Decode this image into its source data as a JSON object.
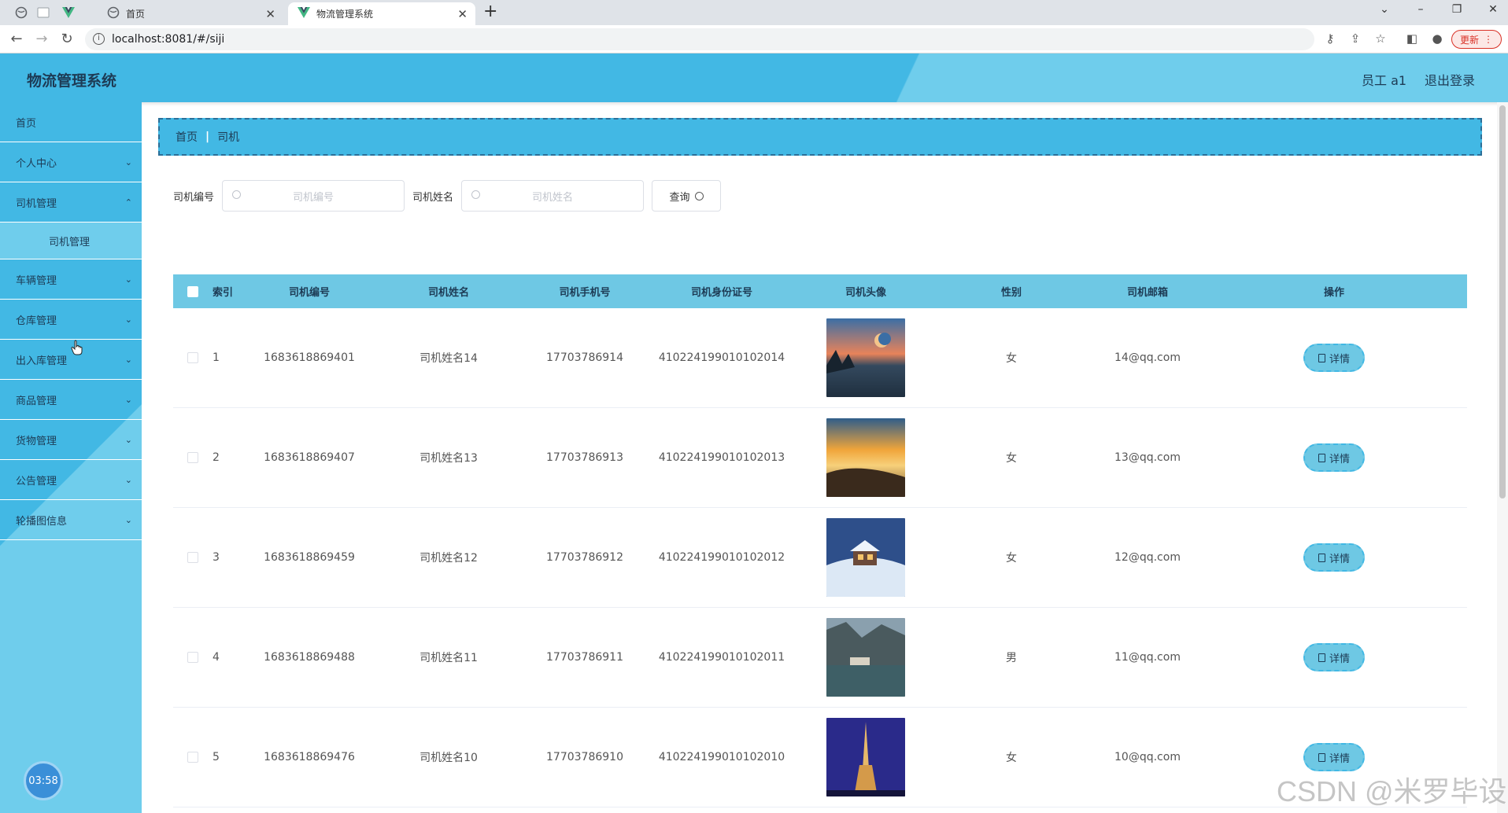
{
  "browser": {
    "tabs": [
      {
        "title": "首页",
        "icon": "globe-icon"
      },
      {
        "title": "物流管理系统",
        "icon": "vue-icon"
      }
    ],
    "url": "localhost:8081/#/siji",
    "update_label": "更新"
  },
  "header": {
    "title": "物流管理系统",
    "user_label": "员工 a1",
    "logout_label": "退出登录"
  },
  "sidebar": {
    "items": [
      {
        "label": "首页"
      },
      {
        "label": "个人中心"
      },
      {
        "label": "司机管理"
      },
      {
        "label": "司机管理"
      },
      {
        "label": "车辆管理"
      },
      {
        "label": "仓库管理"
      },
      {
        "label": "出入库管理"
      },
      {
        "label": "商品管理"
      },
      {
        "label": "货物管理"
      },
      {
        "label": "公告管理"
      },
      {
        "label": "轮播图信息"
      }
    ],
    "clock": "03:58"
  },
  "breadcrumb": {
    "home": "首页",
    "current": "司机"
  },
  "search": {
    "field1_label": "司机编号",
    "field1_placeholder": "司机编号",
    "field2_label": "司机姓名",
    "field2_placeholder": "司机姓名",
    "query_label": "查询"
  },
  "table": {
    "headers": [
      "索引",
      "司机编号",
      "司机姓名",
      "司机手机号",
      "司机身份证号",
      "司机头像",
      "性别",
      "司机邮箱",
      "操作"
    ],
    "rows": [
      {
        "index": "1",
        "number": "1683618869401",
        "name": "司机姓名14",
        "phone": "17703786914",
        "id_card": "410224199010102014",
        "gender": "女",
        "email": "14@qq.com",
        "action": "详情"
      },
      {
        "index": "2",
        "number": "1683618869407",
        "name": "司机姓名13",
        "phone": "17703786913",
        "id_card": "410224199010102013",
        "gender": "女",
        "email": "13@qq.com",
        "action": "详情"
      },
      {
        "index": "3",
        "number": "1683618869459",
        "name": "司机姓名12",
        "phone": "17703786912",
        "id_card": "410224199010102012",
        "gender": "女",
        "email": "12@qq.com",
        "action": "详情"
      },
      {
        "index": "4",
        "number": "1683618869488",
        "name": "司机姓名11",
        "phone": "17703786911",
        "id_card": "410224199010102011",
        "gender": "男",
        "email": "11@qq.com",
        "action": "详情"
      },
      {
        "index": "5",
        "number": "1683618869476",
        "name": "司机姓名10",
        "phone": "17703786910",
        "id_card": "410224199010102010",
        "gender": "女",
        "email": "10@qq.com",
        "action": "详情"
      }
    ]
  },
  "watermark": "CSDN @米罗毕设",
  "colors": {
    "primary": "#42b8e4",
    "secondary": "#6ec8e4",
    "text_dark": "#1d3b55"
  }
}
